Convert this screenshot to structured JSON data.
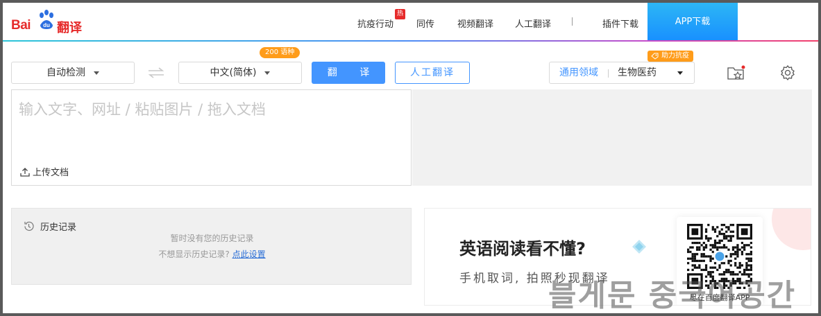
{
  "header": {
    "logo": {
      "bai": "Bai",
      "du": "du",
      "fanyi": "翻译"
    },
    "nav": [
      {
        "label": "抗疫行动",
        "badge": "热"
      },
      {
        "label": "同传"
      },
      {
        "label": "视频翻译"
      },
      {
        "label": "人工翻译"
      },
      {
        "label": "插件下载"
      }
    ],
    "app_download": "APP下载"
  },
  "toolbar": {
    "source_lang": "自动检测",
    "target_lang": "中文(简体)",
    "lang_count_badge": "200 语种",
    "translate_button": "翻 译",
    "human_translate_button": "人工翻译",
    "domain_label": "通用领域",
    "domain_value": "生物医药",
    "support_badge": "助力抗疫"
  },
  "source": {
    "placeholder": "输入文字、网址 / 粘贴图片 / 拖入文档",
    "upload_label": "上传文档"
  },
  "history": {
    "title": "历史记录",
    "empty_text": "暂时没有您的历史记录",
    "hint_text": "不想显示历史记录?",
    "hint_link": "点此设置"
  },
  "promo": {
    "title": "英语阅读看不懂?",
    "subtitle": "手机取词, 拍照秒现翻译",
    "qr_caption": "尽在百度翻译APP"
  },
  "watermark": "블게문 중국어공간",
  "colors": {
    "brand_red": "#e62b2b",
    "primary_blue": "#4395ff",
    "badge_orange": "#ff9c1a"
  }
}
